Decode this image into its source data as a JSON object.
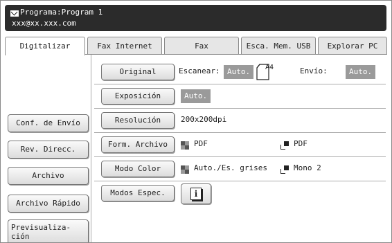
{
  "header": {
    "program_line": "Programa:Program 1",
    "email": "xxx@xx.xxx.com",
    "icon": "mail-icon"
  },
  "tabs": [
    {
      "label": "Digitalizar",
      "active": true
    },
    {
      "label": "Fax Internet",
      "active": false
    },
    {
      "label": "Fax",
      "active": false
    },
    {
      "label": "Esca. Mem. USB",
      "active": false
    },
    {
      "label": "Explorar PC",
      "active": false
    }
  ],
  "left_buttons": {
    "conf_envio": "Conf. de Envío",
    "rev_direcc": "Rev. Direcc.",
    "archivo": "Archivo",
    "archivo_rapido": "Archivo Rápido",
    "previsualizacion_1": "Previsualiza-",
    "previsualizacion_2": "ción"
  },
  "rows": {
    "original": {
      "button": "Original",
      "scan_label": "Escanear:",
      "scan_value": "Auto.",
      "paper_size": "A4",
      "send_label": "Envío:",
      "send_value": "Auto."
    },
    "exposicion": {
      "button": "Exposición",
      "value": "Auto."
    },
    "resolucion": {
      "button": "Resolución",
      "value": "200x200dpi"
    },
    "formato": {
      "button": "Form. Archivo",
      "color_value": "PDF",
      "mono_value": "PDF"
    },
    "modo_color": {
      "button": "Modo Color",
      "color_value": "Auto./Es. grises",
      "mono_value": "Mono 2"
    },
    "modos_espec": {
      "button": "Modos Espec.",
      "info_glyph": "i"
    }
  },
  "colors": {
    "header_bg": "#2b2b2b",
    "badge_bg": "#9a9a9a"
  }
}
